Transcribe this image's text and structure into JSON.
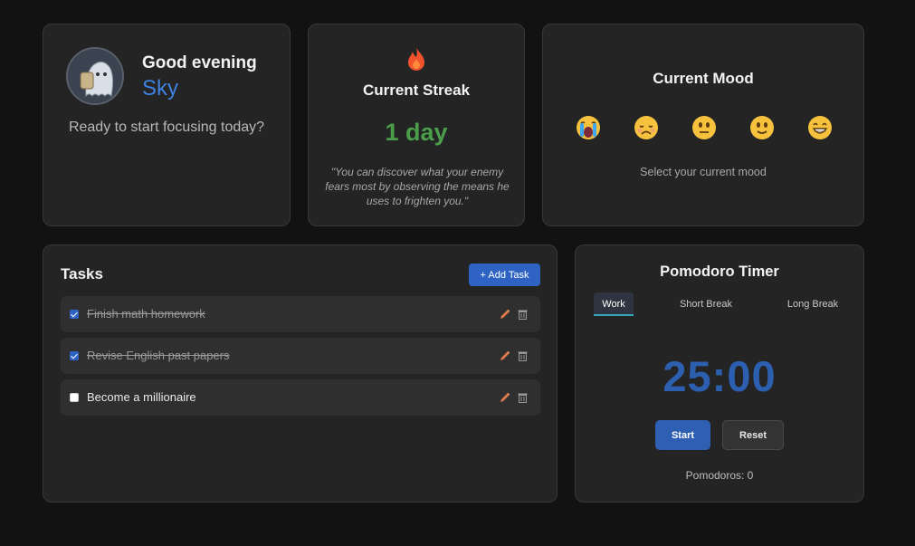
{
  "greeting": {
    "line": "Good evening",
    "name": "Sky",
    "subtitle": "Ready to start focusing today?"
  },
  "streak": {
    "icon": "flame-icon",
    "title": "Current Streak",
    "value": "1 day",
    "quote": "\"You can discover what your enemy fears most by observing the means he uses to frighten you.\""
  },
  "mood": {
    "title": "Current Mood",
    "options": [
      "crying-face-icon",
      "sad-face-icon",
      "neutral-face-icon",
      "slightly-smiling-face-icon",
      "grinning-face-icon"
    ],
    "hint": "Select your current mood"
  },
  "tasks": {
    "title": "Tasks",
    "add_label": "+ Add Task",
    "items": [
      {
        "text": "Finish math homework",
        "done": true
      },
      {
        "text": "Revise English past papers",
        "done": true
      },
      {
        "text": "Become a millionaire",
        "done": false
      }
    ]
  },
  "pomodoro": {
    "title": "Pomodoro Timer",
    "tabs": [
      "Work",
      "Short Break",
      "Long Break"
    ],
    "active_tab": "Work",
    "time": "25:00",
    "start_label": "Start",
    "reset_label": "Reset",
    "count_text": "Pomodoros: 0"
  },
  "colors": {
    "background": "#121212",
    "card": "#242424",
    "accent_blue": "#2e63c4",
    "streak_green": "#4a9e4a",
    "tab_underline": "#36a6b8"
  }
}
